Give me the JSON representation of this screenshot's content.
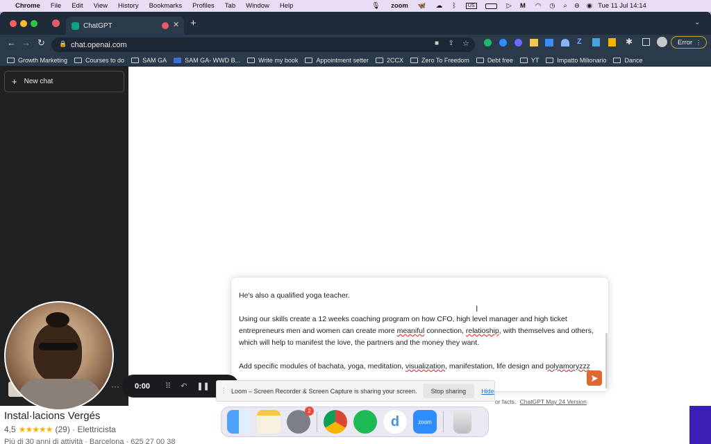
{
  "menubar": {
    "apple_icon": "apple-icon",
    "app_name": "Chrome",
    "items": [
      "File",
      "Edit",
      "View",
      "History",
      "Bookmarks",
      "Profiles",
      "Tab",
      "Window",
      "Help"
    ],
    "zoom_label": "zoom",
    "date_time": "Tue 11 Jul  14:14"
  },
  "browser": {
    "tab_title": "ChatGPT",
    "url": "chat.openai.com",
    "profile_error": "Error",
    "bookmarks": [
      "Growth Marketing",
      "Courses to do",
      "SAM GA",
      "SAM GA- WWD B...",
      "Write my book",
      "Appointment setter",
      "2CCX",
      "Zero To Freedom",
      "Debt free",
      "YT",
      "Impatto Milionario",
      "Dance"
    ]
  },
  "sidebar": {
    "new_chat_label": "New chat"
  },
  "prompt": {
    "line1": "He's also a qualified yoga teacher.",
    "para2_a": "Using our skills create a 12 weeks coaching program on how CFO, high level manager and high ticket entrepreneurs  men and women can create more ",
    "para2_sp1": "meaniful",
    "para2_b": " connection, ",
    "para2_sp2": "relatioship",
    "para2_c": ", with themselves and others, which will help to manifest the love, the partners and the money they want.",
    "para3_a": "Add specific modules of bachata, yoga, meditation, ",
    "para3_sp1": "visualization",
    "para3_b": ", manifestation, life design and ",
    "para3_sp2": "polyamoryzzz"
  },
  "footer": {
    "partial_text": "or facts.",
    "version_link": "ChatGPT May 24 Version"
  },
  "loom": {
    "timer": "0:00",
    "banner_text": "Loom – Screen Recorder & Screen Capture is sharing your screen.",
    "stop_label": "Stop sharing",
    "hide_label": "Hide"
  },
  "background_listing": {
    "title": "Instal·lacions Vergés",
    "rating": "4,5",
    "stars": 4.5,
    "reviews": "(29) · Elettricista",
    "details": "Più di 30 anni di attività · Barcelona · 625 27 00 38"
  },
  "dock": {
    "settings_badge": "2",
    "zoom_label": "zoom",
    "d_label": "d"
  },
  "colors": {
    "send_button": "#e0672f",
    "sidebar": "#202123",
    "chrome_tabstrip": "#202b3a"
  }
}
